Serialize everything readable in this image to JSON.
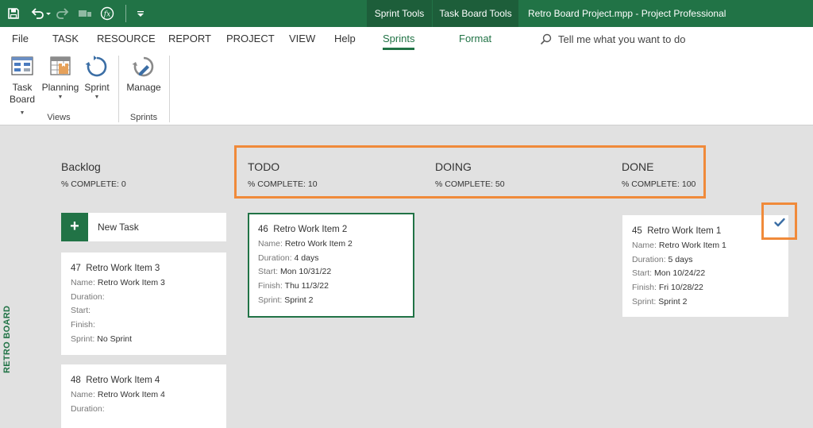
{
  "window": {
    "context_tabs": [
      "Sprint Tools",
      "Task Board Tools"
    ],
    "title": "Retro Board Project.mpp - Project Professional"
  },
  "quick_access": {
    "icons": [
      "save-icon",
      "undo-icon",
      "redo-icon",
      "touch-mode-icon",
      "formula-icon",
      "customize-icon"
    ]
  },
  "ribbon_tabs": [
    "File",
    "TASK",
    "RESOURCE",
    "REPORT",
    "PROJECT",
    "VIEW",
    "Help",
    "Sprints",
    "Format"
  ],
  "active_tab": "Sprints",
  "tell_me": "Tell me what you want to do",
  "ribbon": {
    "views_group": {
      "label": "Views",
      "buttons": [
        {
          "line1": "Task",
          "line2": "Board",
          "has_dropdown": true
        },
        {
          "line1": "Planning",
          "has_dropdown": true
        },
        {
          "line1": "Sprint",
          "has_dropdown": true
        }
      ]
    },
    "sprints_group": {
      "label": "Sprints",
      "buttons": [
        {
          "line1": "Manage"
        }
      ]
    }
  },
  "board": {
    "side_label": "RETRO BOARD",
    "columns": [
      {
        "title": "Backlog",
        "percent": "% COMPLETE: 0"
      },
      {
        "title": "TODO",
        "percent": "% COMPLETE: 10"
      },
      {
        "title": "DOING",
        "percent": "% COMPLETE: 50"
      },
      {
        "title": "DONE",
        "percent": "% COMPLETE: 100"
      }
    ],
    "new_task": {
      "symbol": "+",
      "label": "New Task"
    },
    "field_labels": {
      "name": "Name:",
      "duration": "Duration:",
      "start": "Start:",
      "finish": "Finish:",
      "sprint": "Sprint:"
    },
    "cards": [
      {
        "column": "Backlog",
        "id": "47",
        "title": "Retro Work Item 3",
        "name": "Retro Work Item 3",
        "duration": "",
        "start": "",
        "finish": "",
        "sprint": "No Sprint"
      },
      {
        "column": "Backlog",
        "id": "48",
        "title": "Retro Work Item 4",
        "name": "Retro Work Item 4",
        "duration": "",
        "start": "",
        "finish": "",
        "sprint": ""
      },
      {
        "column": "TODO",
        "id": "46",
        "title": "Retro Work Item 2",
        "name": "Retro Work Item 2",
        "duration": "4 days",
        "start": "Mon 10/31/22",
        "finish": "Thu 11/3/22",
        "sprint": "Sprint 2",
        "selected": true
      },
      {
        "column": "DONE",
        "id": "45",
        "title": "Retro Work Item 1",
        "name": "Retro Work Item 1",
        "duration": "5 days",
        "start": "Mon 10/24/22",
        "finish": "Fri 10/28/22",
        "sprint": "Sprint 2",
        "completed": true
      }
    ]
  },
  "colors": {
    "brand": "#217346",
    "highlight": "#f08a3a",
    "board_bg": "#e1e1e1",
    "check": "#3b6ea5"
  }
}
